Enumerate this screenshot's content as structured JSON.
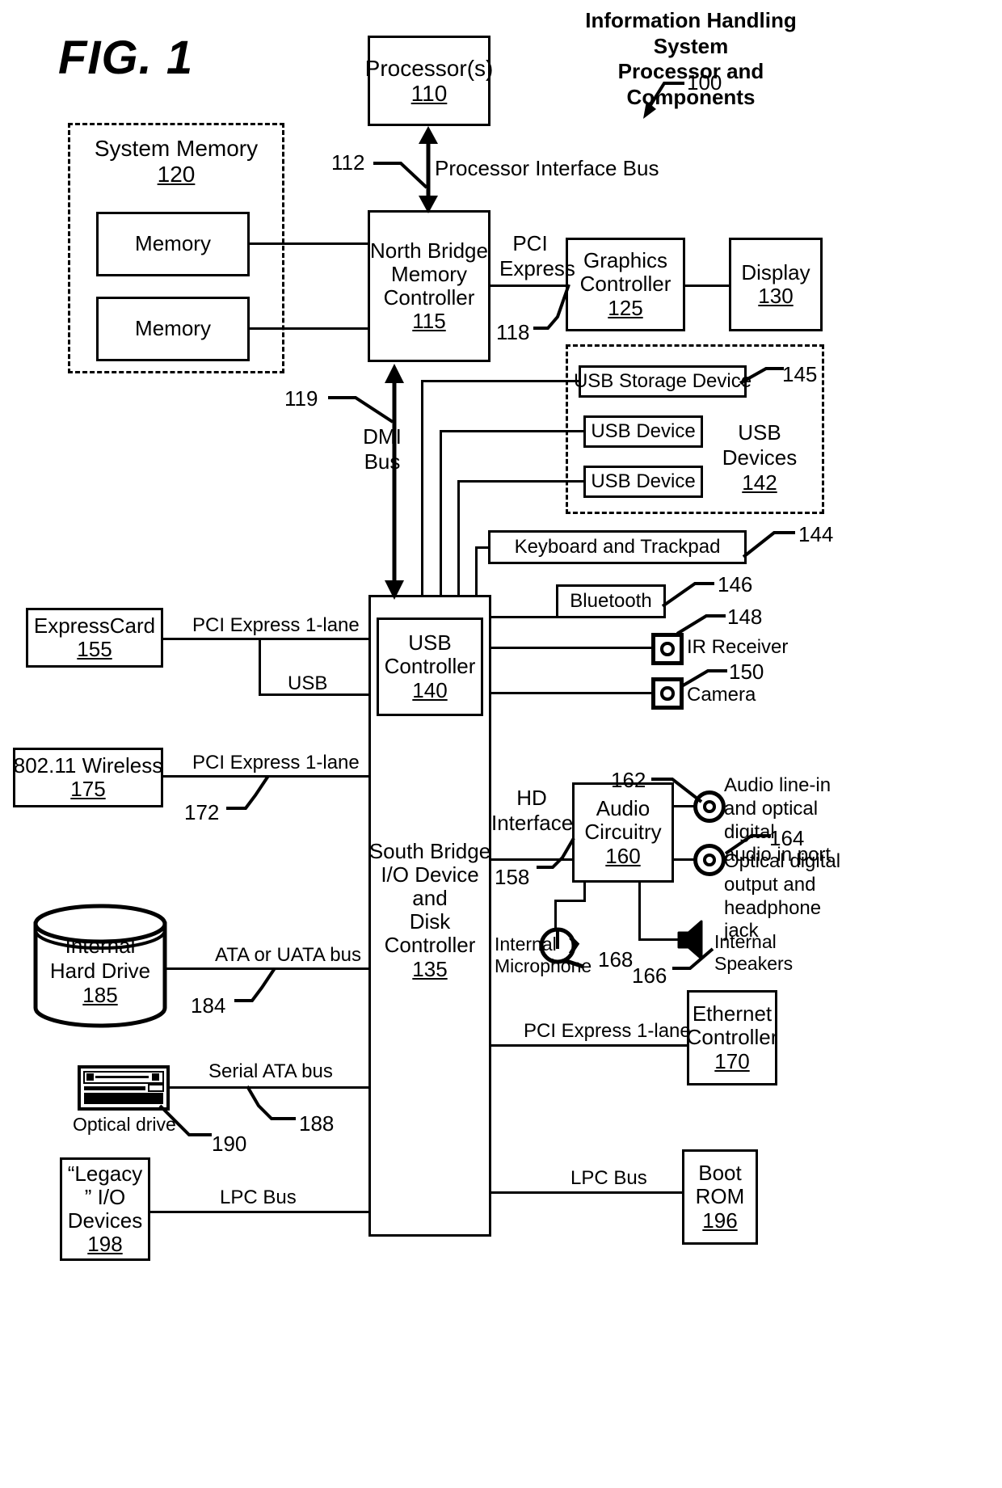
{
  "figure": {
    "label": "FIG. 1",
    "header_line1": "Information Handling System",
    "header_line2": "Processor and Components",
    "ref_100": "100"
  },
  "blocks": {
    "processor": {
      "name": "Processor(s)",
      "num": "110"
    },
    "system_memory": {
      "name": "System Memory",
      "num": "120"
    },
    "memory_1": {
      "name": "Memory"
    },
    "memory_2": {
      "name": "Memory"
    },
    "north_bridge": {
      "l1": "North Bridge",
      "l2": "Memory",
      "l3": "Controller",
      "num": "115"
    },
    "graphics_controller": {
      "l1": "Graphics",
      "l2": "Controller",
      "num": "125"
    },
    "display": {
      "name": "Display",
      "num": "130"
    },
    "usb_storage_device": {
      "name": "USB Storage Device"
    },
    "usb_device_1": {
      "name": "USB Device"
    },
    "usb_device_2": {
      "name": "USB Device"
    },
    "usb_devices_group": {
      "l1": "USB",
      "l2": "Devices",
      "num": "142"
    },
    "keyboard_trackpad": {
      "name": "Keyboard and Trackpad"
    },
    "bluetooth": {
      "name": "Bluetooth"
    },
    "ir_receiver": {
      "name": "IR Receiver"
    },
    "camera": {
      "name": "Camera"
    },
    "usb_controller": {
      "l1": "USB",
      "l2": "Controller",
      "num": "140"
    },
    "expresscard": {
      "name": "ExpressCard",
      "num": "155"
    },
    "wireless": {
      "name": "802.11 Wireless",
      "num": "175"
    },
    "south_bridge": {
      "l1": "South Bridge",
      "l2": "I/O Device",
      "l3": "and",
      "l4": "Disk",
      "l5": "Controller",
      "num": "135"
    },
    "audio_circuitry": {
      "l1": "Audio",
      "l2": "Circuitry",
      "num": "160"
    },
    "internal_hard_drive": {
      "l1": "Internal",
      "l2": "Hard Drive",
      "num": "185"
    },
    "optical_drive": {
      "name": "Optical drive"
    },
    "legacy_io": {
      "l1": "“Legacy",
      "l2": "” I/O",
      "l3": "Devices",
      "num": "198"
    },
    "ethernet_controller": {
      "l1": "Ethernet",
      "l2": "Controller",
      "num": "170"
    },
    "boot_rom": {
      "l1": "Boot",
      "l2": "ROM",
      "num": "196"
    }
  },
  "bus_labels": {
    "processor_interface_bus": "Processor Interface Bus",
    "pci_express_l1": "PCI",
    "pci_express_l2": "Express",
    "dmi_l1": "DMI",
    "dmi_l2": "Bus",
    "pcie_1lane_expresscard": "PCI Express 1-lane",
    "usb": "USB",
    "pcie_1lane_wireless": "PCI Express 1-lane",
    "hd_interface_l1": "HD",
    "hd_interface_l2": "Interface",
    "ata_or_uata_bus": "ATA or UATA bus",
    "serial_ata_bus": "Serial ATA bus",
    "lpc_bus_left": "LPC Bus",
    "pcie_1lane_ethernet": "PCI Express 1-lane",
    "lpc_bus_right": "LPC Bus"
  },
  "peripheral_labels": {
    "audio_in_l1": "Audio line-in",
    "audio_in_l2": "and optical digital",
    "audio_in_l3": "audio in port",
    "audio_out_l1": "Optical digital",
    "audio_out_l2": "output and",
    "audio_out_l3": "headphone jack",
    "internal_microphone_l1": "Internal",
    "internal_microphone_l2": "Microphone",
    "internal_speakers_l1": "Internal",
    "internal_speakers_l2": "Speakers"
  },
  "ref_numbers": {
    "n112": "112",
    "n118": "118",
    "n119": "119",
    "n144": "144",
    "n145": "145",
    "n146": "146",
    "n148": "148",
    "n150": "150",
    "n158": "158",
    "n162": "162",
    "n164": "164",
    "n166": "166",
    "n168": "168",
    "n172": "172",
    "n184": "184",
    "n188": "188",
    "n190": "190"
  },
  "colors": {
    "ink": "#000000",
    "paper": "#ffffff"
  }
}
